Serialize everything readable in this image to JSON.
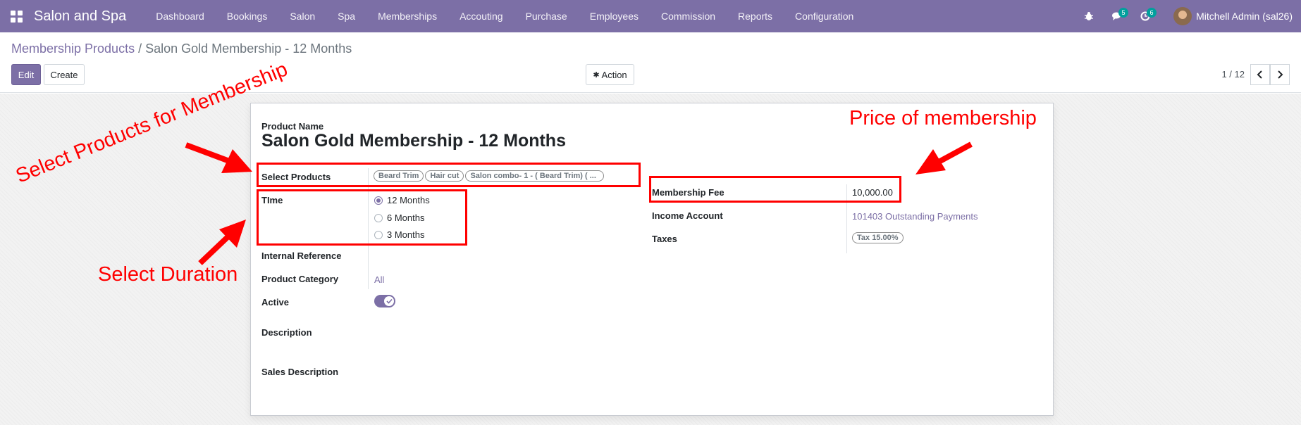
{
  "navbar": {
    "app_name": "Salon and Spa",
    "menu": [
      "Dashboard",
      "Bookings",
      "Salon",
      "Spa",
      "Memberships",
      "Accouting",
      "Purchase",
      "Employees",
      "Commission",
      "Reports",
      "Configuration"
    ],
    "messages_count": "5",
    "activities_count": "6",
    "user_name": "Mitchell Admin (sal26)"
  },
  "breadcrumb": {
    "parent": "Membership Products",
    "separator": "/",
    "current": "Salon Gold Membership - 12 Months"
  },
  "toolbar": {
    "edit_label": "Edit",
    "create_label": "Create",
    "action_label": "Action",
    "pager": "1 / 12"
  },
  "form": {
    "product_name_label": "Product Name",
    "product_name": "Salon Gold Membership - 12 Months",
    "select_products_label": "Select Products",
    "selected_products": [
      "Beard Trim",
      "Hair cut",
      "Salon combo- 1 - ( Beard Trim) ( ..."
    ],
    "time_label": "TIme",
    "time_options": [
      {
        "label": "12 Months",
        "checked": true
      },
      {
        "label": "6 Months",
        "checked": false
      },
      {
        "label": "3 Months",
        "checked": false
      }
    ],
    "internal_reference_label": "Internal Reference",
    "product_category_label": "Product Category",
    "product_category": "All",
    "active_label": "Active",
    "active": true,
    "description_label": "Description",
    "sales_description_label": "Sales Description",
    "membership_fee_label": "Membership Fee",
    "membership_fee": "10,000.00",
    "income_account_label": "Income Account",
    "income_account": "101403 Outstanding Payments",
    "taxes_label": "Taxes",
    "tax": "Tax 15.00%"
  },
  "annotations": {
    "select_products": "Select Products for Membership",
    "select_duration": "Select Duration",
    "price": "Price of membership",
    "color": "#ff0000"
  },
  "colors": {
    "brand": "#7c6fa6",
    "badge": "#00a09d"
  }
}
